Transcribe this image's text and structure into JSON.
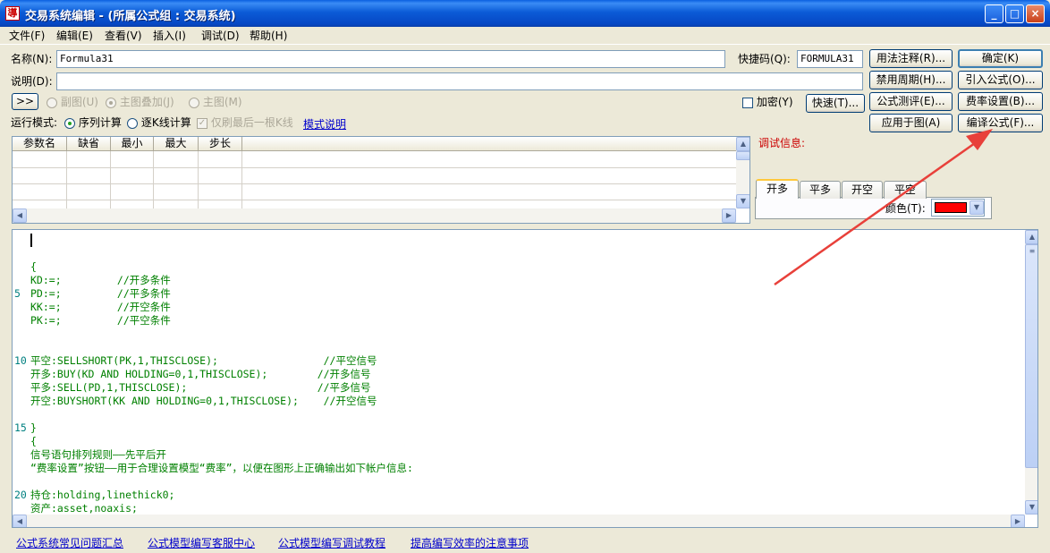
{
  "window": {
    "title": "交易系统编辑 - (所属公式组 : 交易系统)",
    "icon_text": "導",
    "min": "_",
    "max": "□",
    "close": "×"
  },
  "menu": [
    "文件(F)",
    "编辑(E)",
    "查看(V)",
    "插入(I)",
    "调试(D)",
    "帮助(H)"
  ],
  "form": {
    "name_label": "名称(N):",
    "name_value": "Formula31",
    "shortcut_label": "快捷码(Q):",
    "shortcut_value": "FORMULA31",
    "desc_label": "说明(D):",
    "desc_value": "",
    "expand_btn": ">>",
    "radio_sub": "副图(U)",
    "radio_overlay": "主图叠加(J)",
    "radio_main": "主图(M)",
    "encrypt_label": "加密(Y)",
    "quick_btn": "快速(T)...",
    "run_mode_label": "运行模式:",
    "run_seq": "序列计算",
    "run_kline": "逐K线计算",
    "only_last": "仅刷最后一根K线",
    "mode_link": "模式说明"
  },
  "buttons": {
    "usage_notes": "用法注释(R)...",
    "ok": "确定(K)",
    "disable_period": "禁用周期(H)...",
    "import_formula": "引入公式(O)...",
    "formula_test": "公式测评(E)...",
    "fee_settings": "费率设置(B)...",
    "apply_chart": "应用于图(A)",
    "compile": "编译公式(F)..."
  },
  "params": {
    "headers": [
      "参数名",
      "缺省",
      "最小",
      "最大",
      "步长"
    ]
  },
  "debug": {
    "label": "调试信息:",
    "tabs": [
      "开多",
      "平多",
      "开空",
      "平空"
    ],
    "color_label": "颜色(T):",
    "color_value": "#ff0000"
  },
  "code": {
    "lines": [
      {
        "num": "",
        "text": "",
        "cursor": true
      },
      {
        "num": "",
        "text": ""
      },
      {
        "num": "",
        "text": "{"
      },
      {
        "num": "",
        "text": "KD:=;         //开多条件"
      },
      {
        "num": "5",
        "text": "PD:=;         //平多条件"
      },
      {
        "num": "",
        "text": "KK:=;         //开空条件"
      },
      {
        "num": "",
        "text": "PK:=;         //平空条件"
      },
      {
        "num": "",
        "text": ""
      },
      {
        "num": "",
        "text": ""
      },
      {
        "num": "10",
        "text": "平空:SELLSHORT(PK,1,THISCLOSE);                 //平空信号"
      },
      {
        "num": "",
        "text": "开多:BUY(KD AND HOLDING=0,1,THISCLOSE);        //开多信号"
      },
      {
        "num": "",
        "text": "平多:SELL(PD,1,THISCLOSE);                     //平多信号"
      },
      {
        "num": "",
        "text": "开空:BUYSHORT(KK AND HOLDING=0,1,THISCLOSE);    //开空信号"
      },
      {
        "num": "",
        "text": ""
      },
      {
        "num": "15",
        "text": "}"
      },
      {
        "num": "",
        "text": "{"
      },
      {
        "num": "",
        "text": "信号语句排列规则——先平后开"
      },
      {
        "num": "",
        "text": "“费率设置”按钮——用于合理设置模型“费率”，以便在图形上正确输出如下帐户信息:"
      },
      {
        "num": "",
        "text": ""
      },
      {
        "num": "20",
        "text": "持仓:holding,linethick0;"
      },
      {
        "num": "",
        "text": "资产:asset,noaxis;"
      }
    ]
  },
  "footer_links": [
    "公式系统常见问题汇总",
    "公式模型编写客服中心",
    "公式模型编写调试教程",
    "提高编写效率的注意事项"
  ],
  "colors": {
    "arrow": "#e8403a",
    "debug_label": "#cc0000",
    "code": "#008000"
  }
}
